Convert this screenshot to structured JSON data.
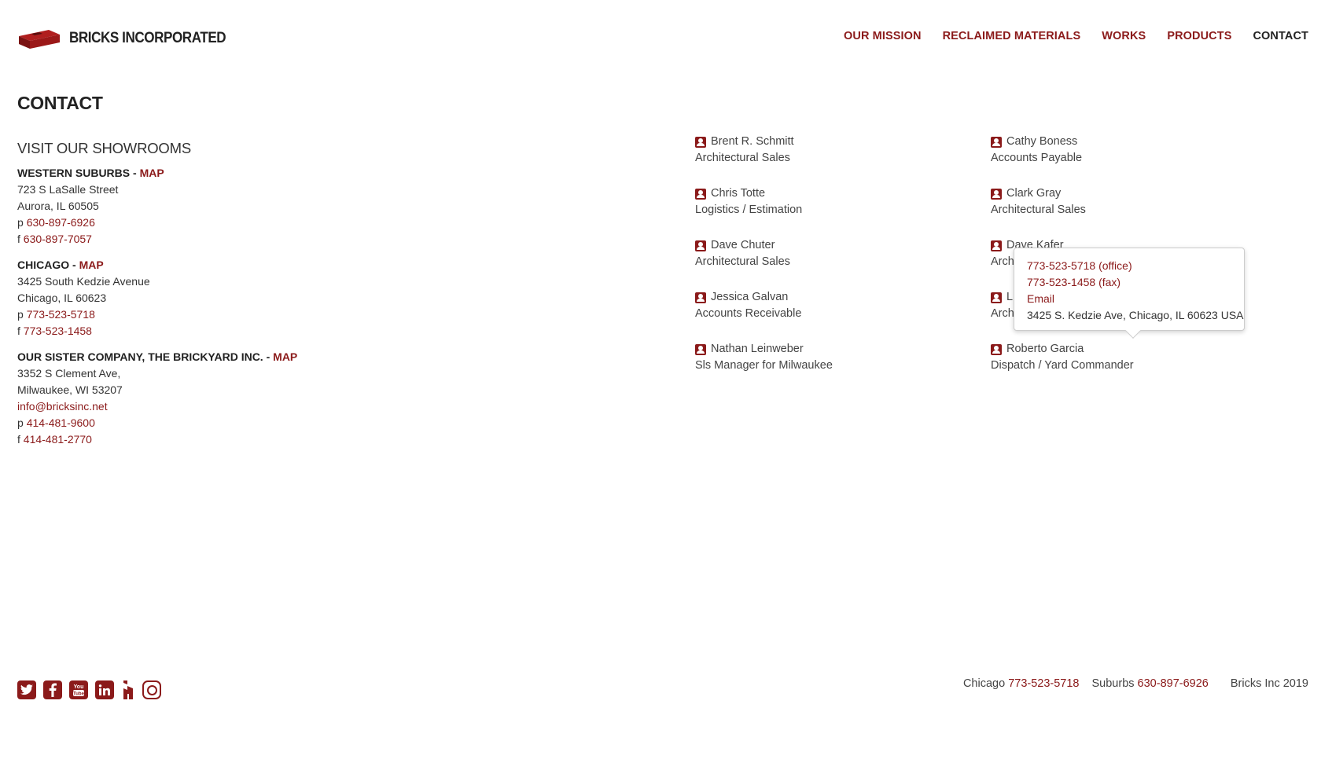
{
  "brand": {
    "name": "BRICKS INCORPORATED",
    "accent": "#8b1a1a"
  },
  "nav": [
    {
      "label": "OUR MISSION"
    },
    {
      "label": "RECLAIMED MATERIALS"
    },
    {
      "label": "WORKS"
    },
    {
      "label": "PRODUCTS"
    },
    {
      "label": "CONTACT"
    }
  ],
  "page_title": "CONTACT",
  "showrooms": {
    "heading": "VISIT OUR SHOWROOMS",
    "locations": [
      {
        "name": "WESTERN SUBURBS",
        "sep": " - ",
        "map": "MAP",
        "addr1": "723 S LaSalle Street",
        "addr2": "Aurora, IL 60505",
        "p_prefix": "p ",
        "phone": "630-897-6926",
        "f_prefix": "f ",
        "fax": "630-897-7057"
      },
      {
        "name": "CHICAGO",
        "sep": " - ",
        "map": "MAP",
        "addr1": "3425 South Kedzie Avenue",
        "addr2": "Chicago, IL 60623",
        "p_prefix": "p ",
        "phone": "773-523-5718",
        "f_prefix": "f ",
        "fax": "773-523-1458"
      },
      {
        "name": "OUR SISTER COMPANY, THE BRICKYARD INC.",
        "sep": " - ",
        "map": "MAP",
        "addr1": "3352 S Clement Ave,",
        "addr2": "Milwaukee, WI 53207",
        "email": "info@bricksinc.net",
        "p_prefix": "p ",
        "phone": "414-481-9600",
        "f_prefix": "f ",
        "fax": "414-481-2770"
      }
    ]
  },
  "staff_col1": [
    {
      "name": "Brent R. Schmitt",
      "role": "Architectural Sales"
    },
    {
      "name": "Chris Totte",
      "role": "Logistics / Estimation"
    },
    {
      "name": "Dave Chuter",
      "role": "Architectural Sales"
    },
    {
      "name": "Jessica Galvan",
      "role": "Accounts Receivable"
    },
    {
      "name": "Nathan Leinweber",
      "role": "Sls Manager for Milwaukee"
    }
  ],
  "staff_col2": [
    {
      "name": "Cathy Boness",
      "role": "Accounts Payable"
    },
    {
      "name": "Clark Gray",
      "role": "Architectural Sales"
    },
    {
      "name": "Dave Kafer",
      "role": "Archi"
    },
    {
      "name": "Lu",
      "role": "Archi"
    },
    {
      "name": "Roberto Garcia",
      "role": "Dispatch / Yard Commander"
    }
  ],
  "popover": {
    "office": "773-523-5718 (office)",
    "fax": "773-523-1458 (fax)",
    "email": "Email",
    "address": "3425 S. Kedzie Ave, Chicago, IL 60623 USA"
  },
  "footer": {
    "social": [
      "twitter-icon",
      "facebook-icon",
      "youtube-icon",
      "linkedin-icon",
      "houzz-icon",
      "instagram-icon"
    ],
    "chicago_label": "Chicago",
    "chicago_phone": "773-523-5718",
    "suburbs_label": "Suburbs",
    "suburbs_phone": "630-897-6926",
    "copyright": "Bricks Inc 2019"
  }
}
